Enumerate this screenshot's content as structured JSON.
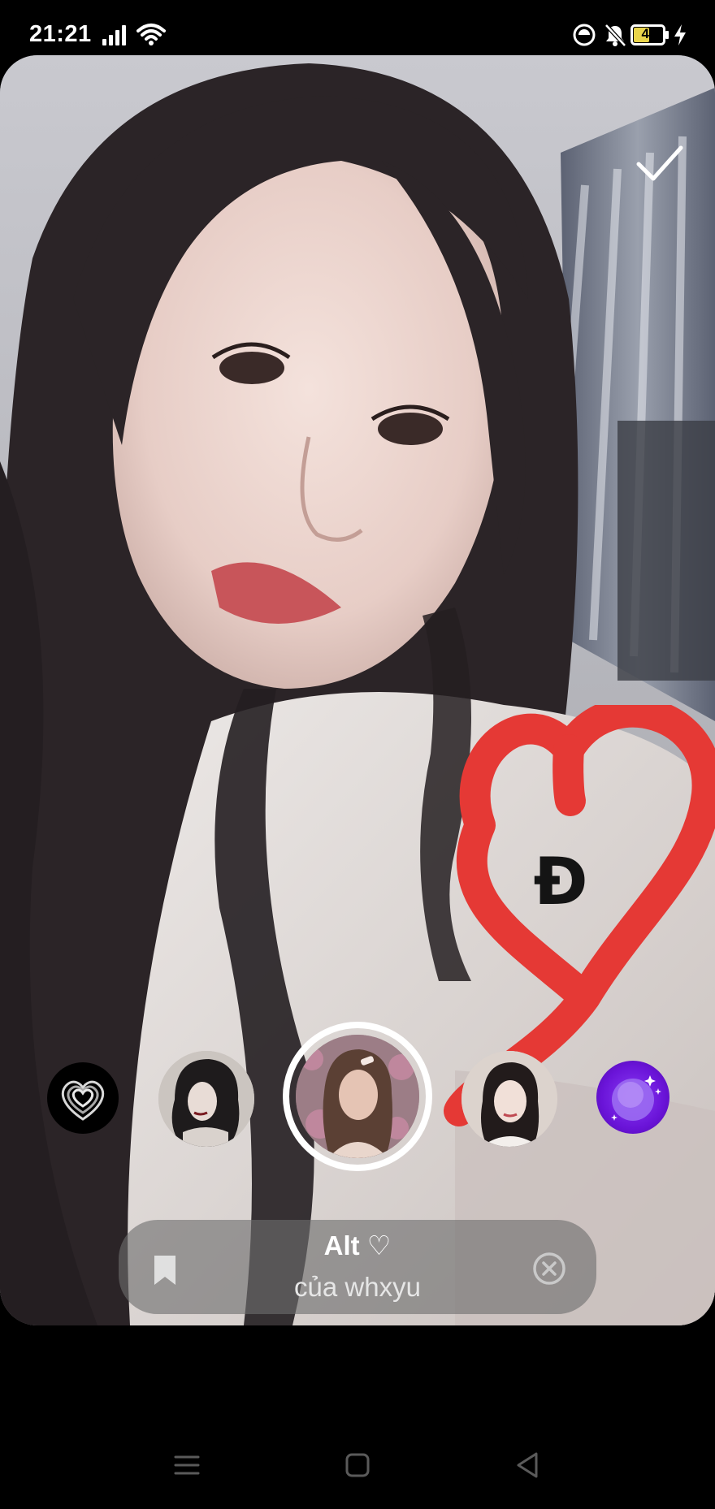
{
  "status_bar": {
    "time": "21:21",
    "battery_level": "47",
    "icons": [
      "signal-icon",
      "wifi-icon",
      "screen-record-icon",
      "bell-muted-icon",
      "battery-icon",
      "charging-icon"
    ]
  },
  "camera": {
    "done_icon": "checkmark-icon",
    "sticker_letter": "Đ",
    "drawing": {
      "shape": "heart-doodle",
      "color": "#e53935"
    }
  },
  "effects": {
    "items": [
      {
        "name": "heart-spiral-effect",
        "selected": false
      },
      {
        "name": "gothic-portrait-effect",
        "selected": false
      },
      {
        "name": "alt-effect",
        "selected": true
      },
      {
        "name": "girl-portrait-effect",
        "selected": false
      },
      {
        "name": "galaxy-orb-effect",
        "selected": false
      }
    ],
    "selected": {
      "title": "Alt ♡",
      "author": "của whxyu",
      "bookmark_icon": "bookmark-icon",
      "remove_icon": "close-circle-icon"
    }
  },
  "nav": {
    "icons": [
      "menu-icon",
      "home-square-icon",
      "back-triangle-icon"
    ]
  },
  "colors": {
    "accent_heart": "#e53935",
    "pill_bg": "rgba(110,110,110,0.62)",
    "galaxy": "#7a20ea"
  }
}
